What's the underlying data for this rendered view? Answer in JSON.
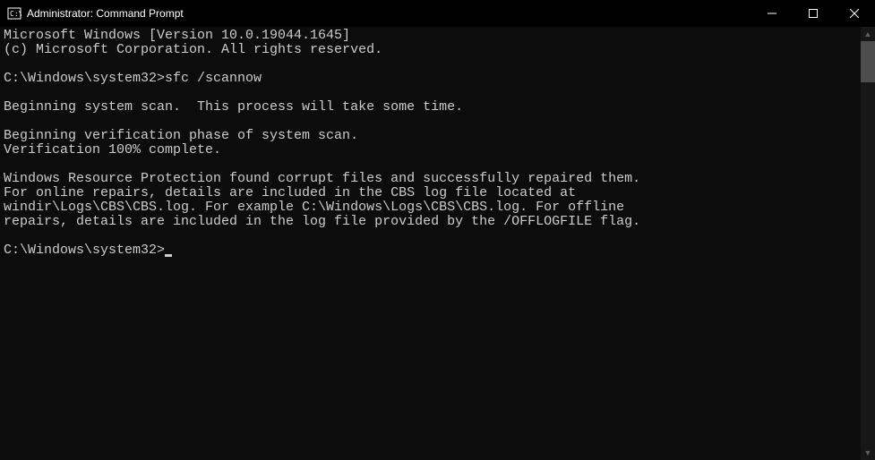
{
  "window": {
    "title": "Administrator: Command Prompt"
  },
  "console": {
    "lines": [
      "Microsoft Windows [Version 10.0.19044.1645]",
      "(c) Microsoft Corporation. All rights reserved.",
      "",
      "C:\\Windows\\system32>sfc /scannow",
      "",
      "Beginning system scan.  This process will take some time.",
      "",
      "Beginning verification phase of system scan.",
      "Verification 100% complete.",
      "",
      "Windows Resource Protection found corrupt files and successfully repaired them.",
      "For online repairs, details are included in the CBS log file located at",
      "windir\\Logs\\CBS\\CBS.log. For example C:\\Windows\\Logs\\CBS\\CBS.log. For offline",
      "repairs, details are included in the log file provided by the /OFFLOGFILE flag.",
      ""
    ],
    "prompt": "C:\\Windows\\system32>"
  }
}
